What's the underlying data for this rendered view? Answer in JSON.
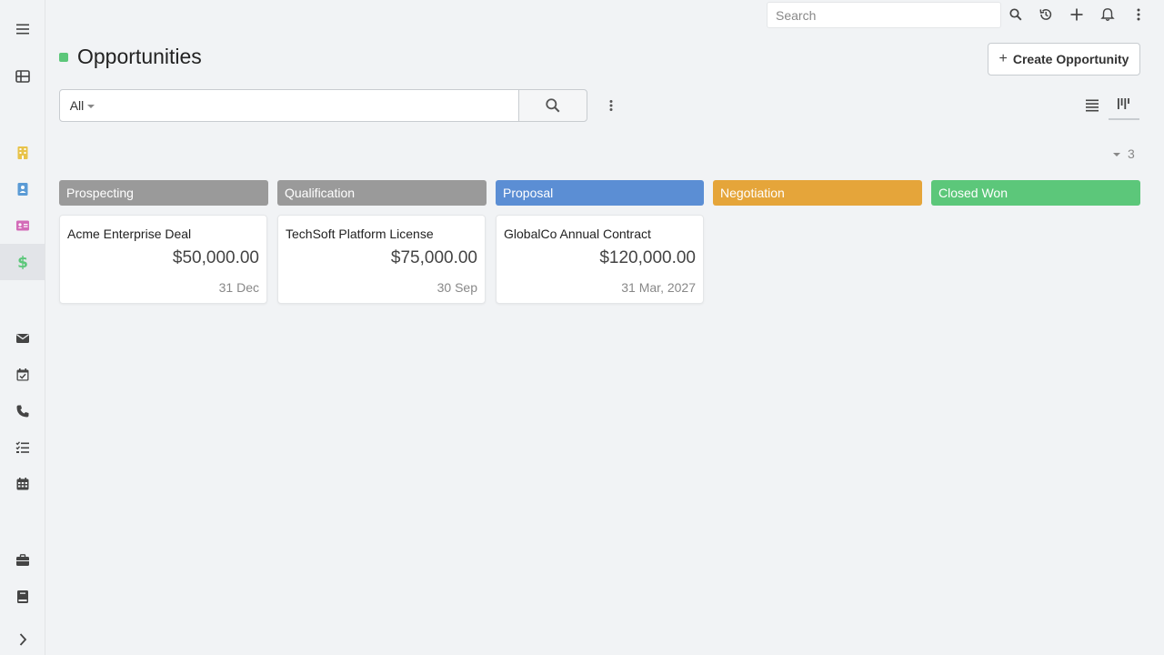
{
  "app": {
    "title": "Opportunities",
    "create_button": "Create Opportunity",
    "create_plus": "+"
  },
  "topbar": {
    "search_placeholder": "Search"
  },
  "search": {
    "filter_label": "All",
    "value": ""
  },
  "total_count": "3",
  "colors": {
    "accent_green": "#5cc77a",
    "prospecting": "#9a9a9a",
    "qualification": "#9a9a9a",
    "proposal": "#5b8ed4",
    "negotiation": "#e5a53a",
    "closed_won": "#5cc77a"
  },
  "sidebar": {
    "items": [
      {
        "icon": "menu-icon"
      },
      {
        "icon": "grid-icon"
      },
      {
        "icon": "building-icon"
      },
      {
        "icon": "contact-book-icon"
      },
      {
        "icon": "id-card-icon"
      },
      {
        "icon": "dollar-icon",
        "active": true
      },
      {
        "icon": "envelope-icon"
      },
      {
        "icon": "calendar-check-icon"
      },
      {
        "icon": "phone-icon"
      },
      {
        "icon": "tasks-icon"
      },
      {
        "icon": "calendar-icon"
      },
      {
        "icon": "briefcase-icon"
      },
      {
        "icon": "book-icon"
      },
      {
        "icon": "chevron-right-icon"
      }
    ]
  },
  "columns": [
    {
      "label": "Prospecting"
    },
    {
      "label": "Qualification"
    },
    {
      "label": "Proposal"
    },
    {
      "label": "Negotiation"
    },
    {
      "label": "Closed Won"
    }
  ],
  "cards": [
    {
      "name": "Acme Enterprise Deal",
      "amount": "$50,000.00",
      "date": "31 Dec"
    },
    {
      "name": "TechSoft Platform License",
      "amount": "$75,000.00",
      "date": "30 Sep"
    },
    {
      "name": "GlobalCo Annual Contract",
      "amount": "$120,000.00",
      "date": "31 Mar, 2027"
    }
  ]
}
